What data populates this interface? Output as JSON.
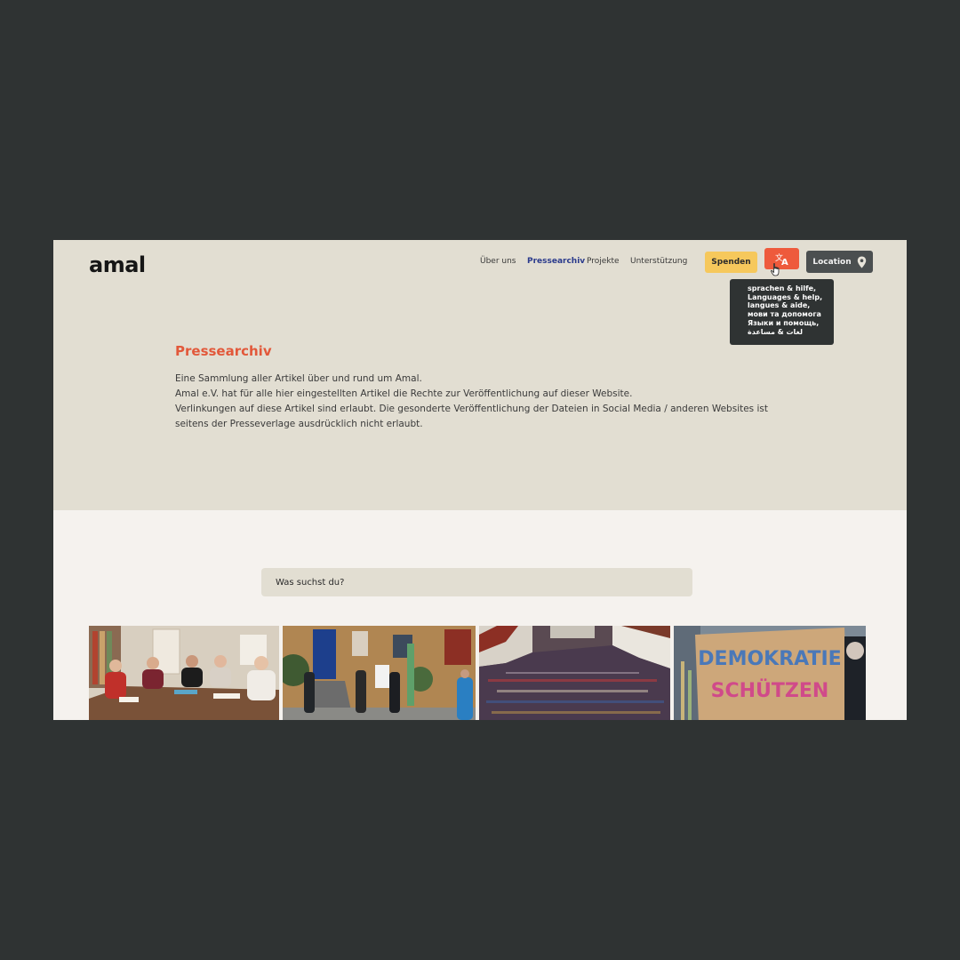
{
  "brand": {
    "logo_text": "amal"
  },
  "nav": {
    "items": [
      {
        "label": "Über uns",
        "active": false
      },
      {
        "label": "Pressearchiv",
        "active": true
      },
      {
        "label": "Projekte",
        "active": false
      },
      {
        "label": "Unterstützung",
        "active": false
      }
    ]
  },
  "actions": {
    "spenden_label": "Spenden",
    "lang_icon": "translate-icon",
    "location_label": "Location",
    "location_icon": "map-pin-icon"
  },
  "language_tooltip": {
    "lines": [
      "sprachen & hilfe,",
      "Languages & help,",
      "langues & aide,",
      "мови та допомога",
      "Языки и помощь,",
      "لغات & مساعدة"
    ]
  },
  "hero": {
    "title": "Pressearchiv",
    "paragraph_lines": [
      "Eine Sammlung aller Artikel über und rund um Amal.",
      "Amal e.V. hat für alle hier eingestellten Artikel die Rechte zur Veröffentlichung auf dieser Website.",
      "Verlinkungen auf diese Artikel sind erlaubt. Die gesonderte Veröffentlichung der Dateien in Social Media / anderen Websites ist",
      "seitens der Presseverlage ausdrücklich nicht erlaubt."
    ]
  },
  "search": {
    "placeholder": "Was suchst du?",
    "value": ""
  },
  "articles": [
    {
      "image": "group-at-table-photo"
    },
    {
      "image": "building-entrance-photo"
    },
    {
      "image": "crowd-demonstration-photo"
    },
    {
      "image": "protest-sign-photo",
      "sign_lines": [
        "DEMOKRATIE",
        "SCHÜTZEN"
      ]
    }
  ],
  "colors": {
    "background": "#2f3333",
    "hero": "#e2ded2",
    "accent": "#e2583a",
    "donate": "#f6c85c",
    "lang_button": "#ee5a3c",
    "location_button": "#4b4f50"
  }
}
